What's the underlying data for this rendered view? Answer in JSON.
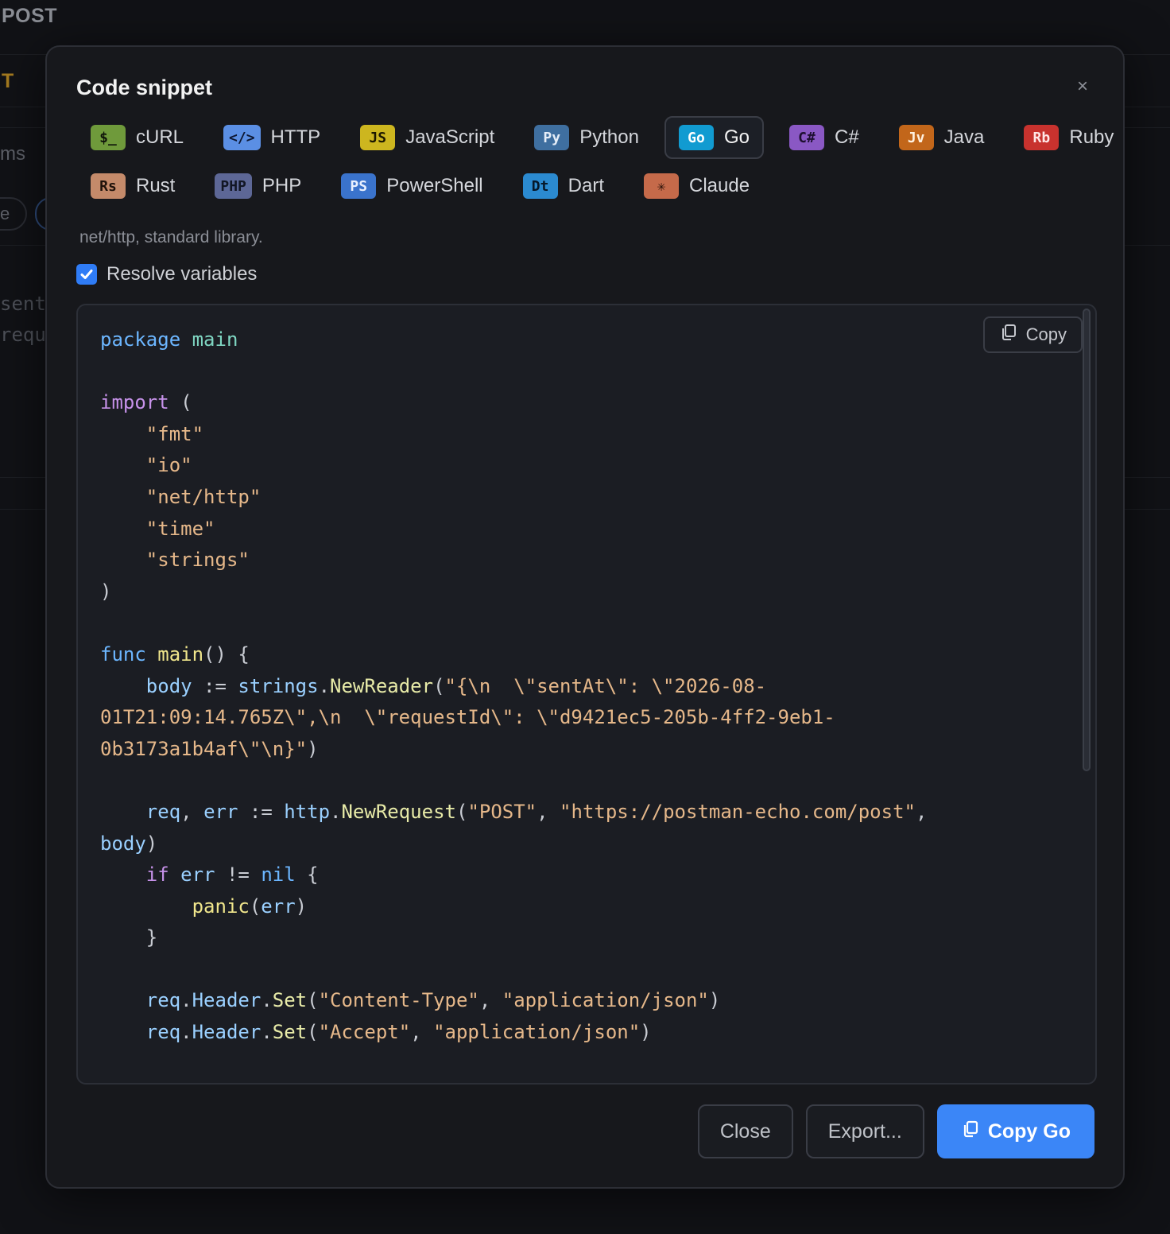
{
  "background": {
    "method": "POST",
    "method_short": "T",
    "params_fragment": "ms",
    "pill_fragment": "e",
    "code_fragment_1": "sent",
    "code_fragment_2": "requ"
  },
  "modal": {
    "title": "Code snippet",
    "close_icon": "×",
    "languages_row1": [
      {
        "badge": "$_",
        "label": "cURL",
        "badge_bg": "#6f9a3b",
        "badge_fg": "#10150a",
        "active": false
      },
      {
        "badge": "</>",
        "label": "HTTP",
        "badge_bg": "#5b8fe4",
        "badge_fg": "#0c1630",
        "active": false
      },
      {
        "badge": "JS",
        "label": "JavaScript",
        "badge_bg": "#cdb61f",
        "badge_fg": "#1b1700",
        "active": false
      },
      {
        "badge": "Py",
        "label": "Python",
        "badge_bg": "#3f6fa0",
        "badge_fg": "#e6eef8",
        "active": false
      },
      {
        "badge": "Go",
        "label": "Go",
        "badge_bg": "#119bd1",
        "badge_fg": "#ffffff",
        "active": true
      },
      {
        "badge": "C#",
        "label": "C#",
        "badge_bg": "#8a58c4",
        "badge_fg": "#1e0f30",
        "active": false
      },
      {
        "badge": "Jv",
        "label": "Java",
        "badge_bg": "#c2661a",
        "badge_fg": "#fff1e0",
        "active": false
      },
      {
        "badge": "Rb",
        "label": "Ruby",
        "badge_bg": "#c8322e",
        "badge_fg": "#ffe6e6",
        "active": false
      }
    ],
    "languages_row2": [
      {
        "badge": "Rs",
        "label": "Rust",
        "badge_bg": "#c48a6a",
        "badge_fg": "#1f120a",
        "active": false
      },
      {
        "badge": "PHP",
        "label": "PHP",
        "badge_bg": "#5d6796",
        "badge_fg": "#121624",
        "active": false
      },
      {
        "badge": "PS",
        "label": "PowerShell",
        "badge_bg": "#3a73cc",
        "badge_fg": "#e8f0ff",
        "active": false
      },
      {
        "badge": "Dt",
        "label": "Dart",
        "badge_bg": "#2b8ad0",
        "badge_fg": "#06182a",
        "active": false
      },
      {
        "badge": "✳",
        "label": "Claude",
        "badge_bg": "#c56a4a",
        "badge_fg": "#2a120a",
        "active": false
      }
    ],
    "description": "net/http, standard library.",
    "resolve_variables": {
      "label": "Resolve variables",
      "checked": true
    },
    "copy_inline_label": "Copy",
    "footer": {
      "close_label": "Close",
      "export_label": "Export...",
      "copy_label": "Copy Go"
    },
    "accent_color": "#3b86f7"
  },
  "code": {
    "package_kw": "package",
    "package_name": "main",
    "import_kw": "import",
    "imports": [
      "\"fmt\"",
      "\"io\"",
      "\"net/http\"",
      "\"time\"",
      "\"strings\""
    ],
    "func_kw": "func",
    "func_name": "main",
    "body_var": "body",
    "strings_pkg": "strings",
    "new_reader": "NewReader",
    "body_str_1": "\"{\\n  \\\"sentAt\\\": \\\"2026-08-",
    "body_str_2": "01T21:09:14.765Z\\\",\\n  \\\"requestId\\\": \\\"d9421ec5-205b-4ff2-9eb1-",
    "body_str_3": "0b3173a1b4af\\\"\\n}\"",
    "req_var": "req",
    "err_var": "err",
    "http_pkg": "http",
    "new_request": "NewRequest",
    "post_str": "\"POST\"",
    "url_str": "\"https://postman-echo.com/post\"",
    "if_kw": "if",
    "nil_kw": "nil",
    "panic_fn": "panic",
    "header": "Header",
    "set": "Set",
    "ct_key": "\"Content-Type\"",
    "ct_val": "\"application/json\"",
    "accept_key": "\"Accept\"",
    "accept_val": "\"application/json\""
  }
}
